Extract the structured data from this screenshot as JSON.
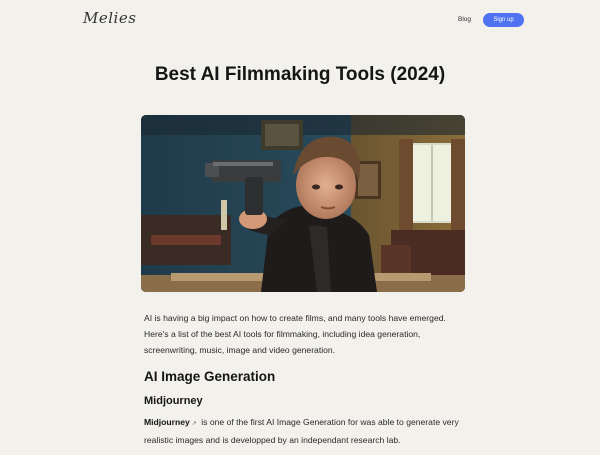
{
  "header": {
    "logo": "Melies",
    "nav_blog": "Blog",
    "signup_label": "Sign up"
  },
  "article": {
    "title": "Best AI Filmmaking Tools (2024)",
    "intro": "AI is having a big impact on how to create films, and many tools have emerged. Here's a list of the best AI tools for filmmaking, including idea generation, screenwriting, music, image and video generation.",
    "section_heading": "AI Image Generation",
    "tool_heading": "Midjourney",
    "tool_link": "Midjourney",
    "tool_link_icon": "external-link-icon",
    "tool_description": " is one of the first AI Image Generation for was able to generate very realistic images and is developped by an independant research lab."
  },
  "colors": {
    "background": "#f3f1ec",
    "accent": "#4f73f0"
  }
}
